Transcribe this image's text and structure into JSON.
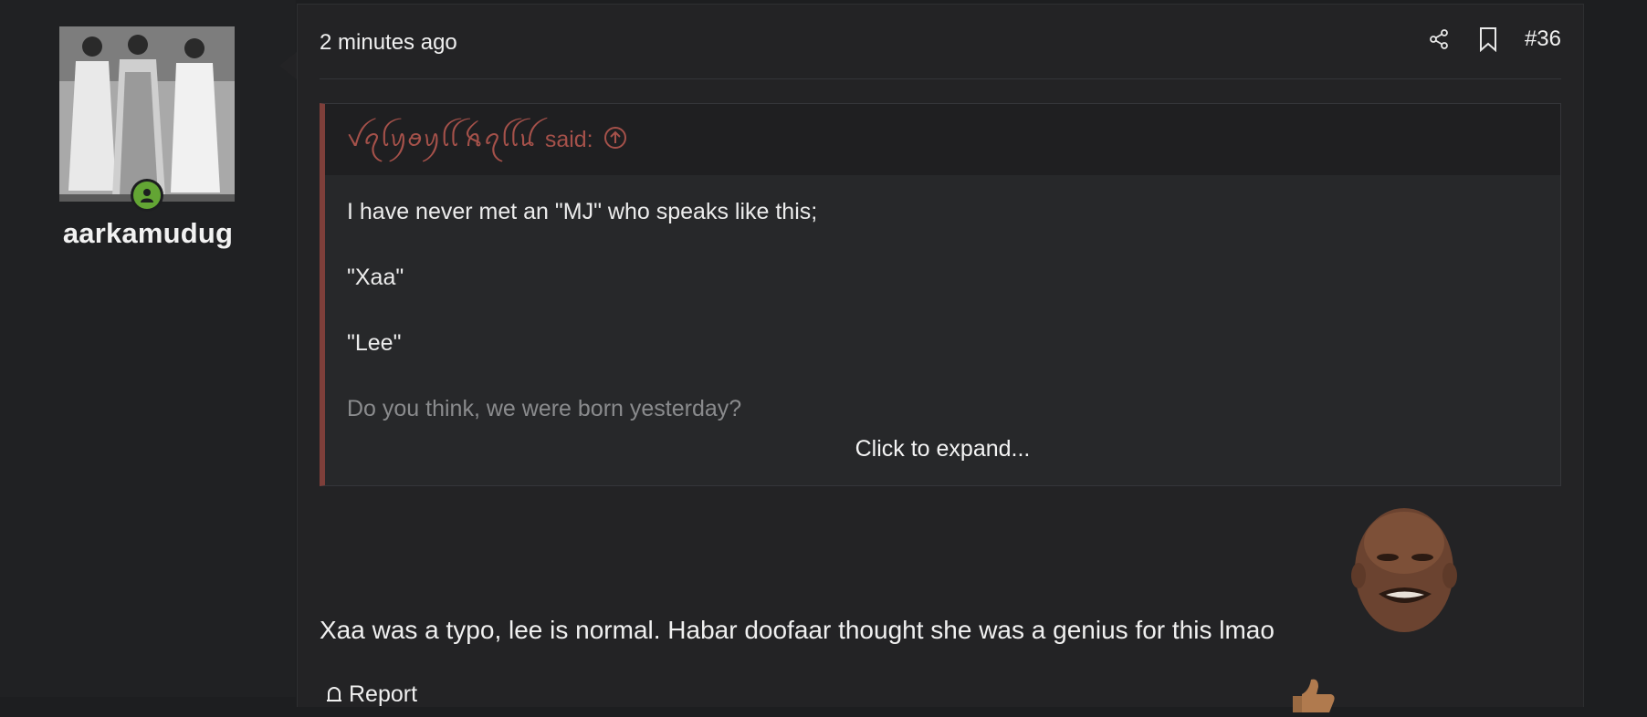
{
  "user": {
    "username": "aarkamudug",
    "status": "online"
  },
  "post": {
    "time": "2 minutes ago",
    "number": "#36",
    "actions": {
      "share_icon": "share-icon",
      "bookmark_icon": "bookmark-icon"
    },
    "quote": {
      "author": "ꪜꪖꪶꪗꪮꪗꪶꪶ ꫝꪖꪶꪶꪊ",
      "said": "said:",
      "lines": [
        "I have never met an \"MJ\" who speaks like this;",
        "\"Xaa\"",
        "\"Lee\"",
        "Do you think, we were born yesterday?"
      ],
      "expand_label": "Click to expand..."
    },
    "reply": "Xaa was a typo, lee is normal. Habar doofaar thought she was a genius for this lmao",
    "report_label": "Report"
  },
  "colors": {
    "accent_quote": "#7e3f3a",
    "quote_author": "#a5514a",
    "online": "#63a534"
  }
}
